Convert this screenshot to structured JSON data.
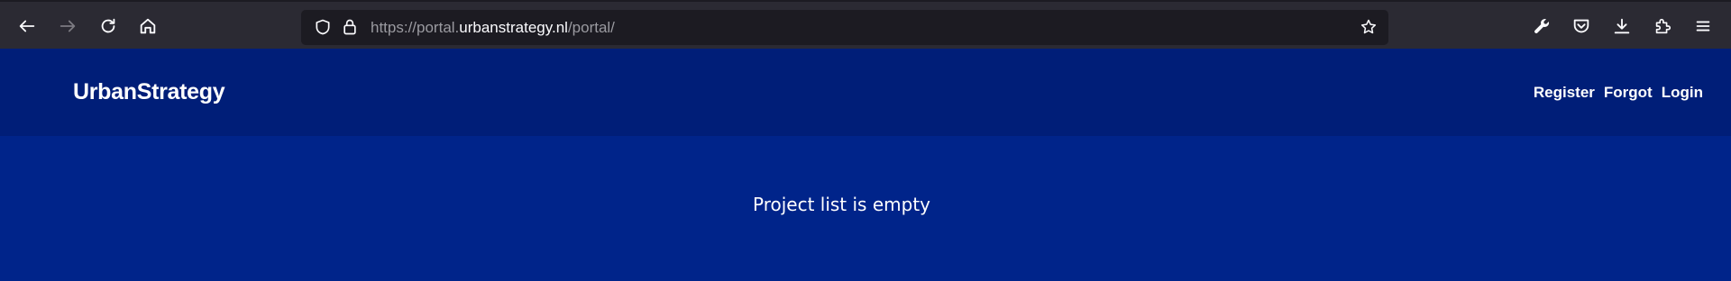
{
  "browser": {
    "url_prefix": "https://portal.",
    "url_host": "urbanstrategy.nl",
    "url_path": "/portal/",
    "icons": {
      "back": "back-arrow-icon",
      "forward": "forward-arrow-icon",
      "reload": "reload-icon",
      "home": "home-icon",
      "shield": "tracking-protection-shield-icon",
      "lock": "lock-icon",
      "bookmark": "star-icon",
      "tools": "wrench-icon",
      "pocket": "pocket-icon",
      "downloads": "download-icon",
      "extensions": "puzzle-icon",
      "menu": "hamburger-menu-icon"
    }
  },
  "header": {
    "brand": "UrbanStrategy",
    "nav": {
      "register": "Register",
      "forgot": "Forgot",
      "login": "Login"
    }
  },
  "main": {
    "empty_message": "Project list is empty"
  },
  "colors": {
    "header_bg": "#001e78",
    "content_bg": "#00248a",
    "toolbar_bg": "#2b2a33"
  }
}
